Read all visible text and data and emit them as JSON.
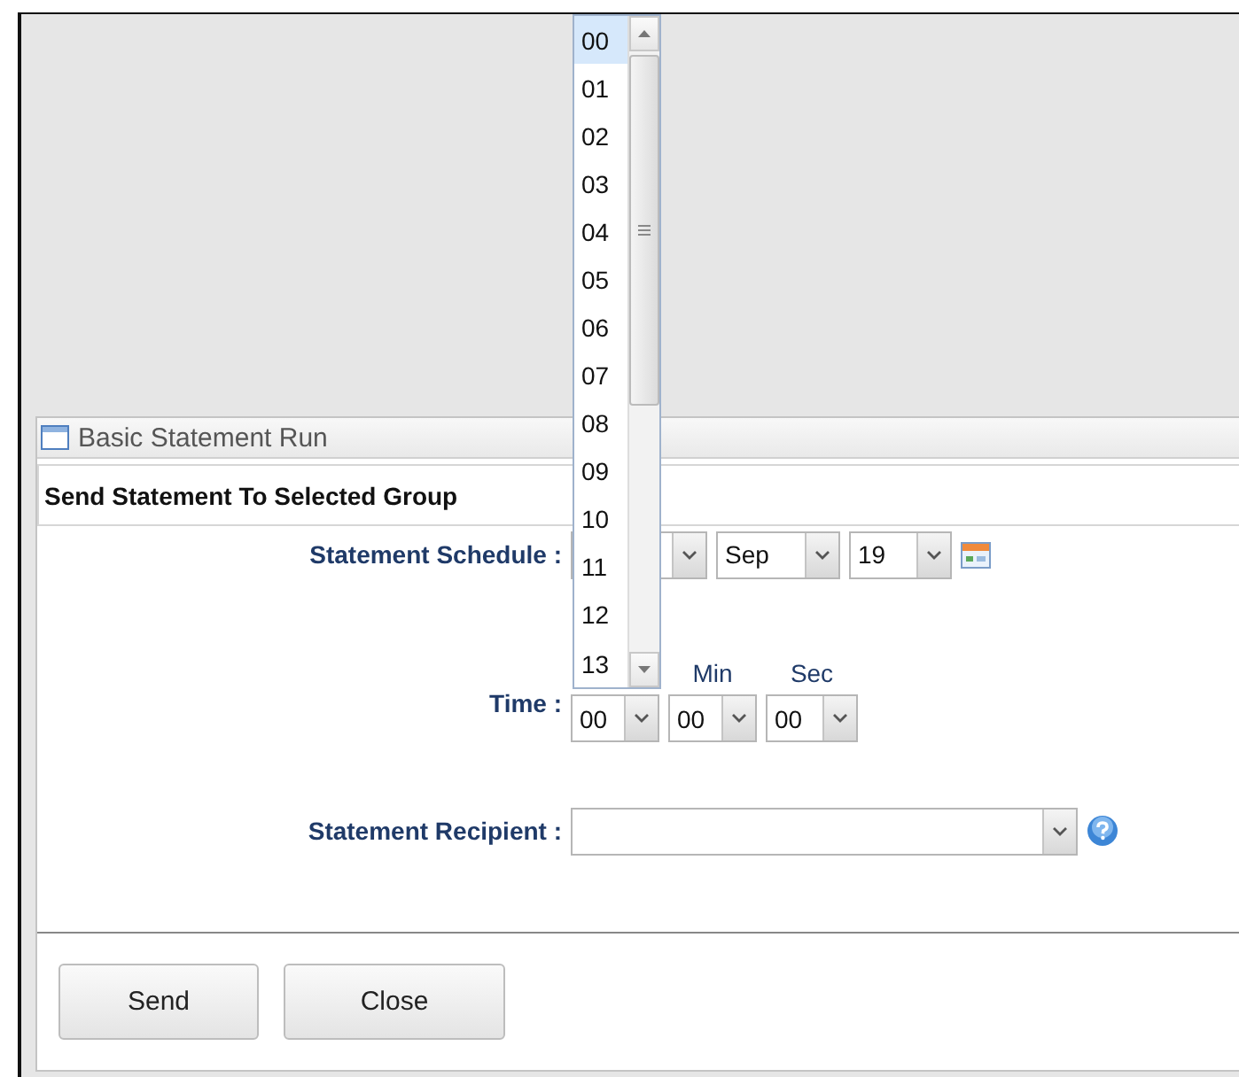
{
  "panel": {
    "title": "Basic Statement Run",
    "header": "Send Statement To Selected Group",
    "rows": [
      {
        "kind": "date",
        "label": "Statement Schedule :",
        "month": "Sep",
        "day": "19"
      },
      {
        "kind": "time",
        "label": "Time :",
        "hour": "00",
        "minute_label": "Min",
        "minute": "00",
        "second_label": "Sec",
        "second": "00"
      },
      {
        "kind": "combo",
        "label": "Statement Recipient :"
      }
    ],
    "buttons": [
      "Send",
      "Close"
    ]
  },
  "dropdown": {
    "options": [
      {
        "label": "00",
        "selected": true
      },
      {
        "label": "01",
        "selected": false
      },
      {
        "label": "02",
        "selected": false
      },
      {
        "label": "03",
        "selected": false
      },
      {
        "label": "04",
        "selected": false
      },
      {
        "label": "05",
        "selected": false
      },
      {
        "label": "06",
        "selected": false
      },
      {
        "label": "07",
        "selected": false
      },
      {
        "label": "08",
        "selected": false
      },
      {
        "label": "09",
        "selected": false
      },
      {
        "label": "10",
        "selected": false
      },
      {
        "label": "11",
        "selected": false
      },
      {
        "label": "12",
        "selected": false
      },
      {
        "label": "13",
        "selected": false
      }
    ]
  }
}
